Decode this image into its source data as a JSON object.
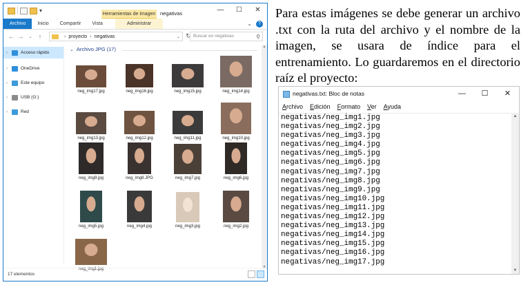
{
  "explorer": {
    "context_tab": "Herramientas de imagen",
    "window_title": "negativas",
    "tabs": [
      "Archivo",
      "Inicio",
      "Compartir",
      "Vista"
    ],
    "manage_tab": "Administrar",
    "breadcrumb": [
      "proyecto",
      "negativas"
    ],
    "search_placeholder": "Buscar en negativas",
    "nav_items": [
      {
        "label": "Acceso rápido",
        "icon": "star-icon",
        "selected": true
      },
      {
        "label": "OneDrive",
        "icon": "cloud-icon",
        "selected": false
      },
      {
        "label": "Este equipo",
        "icon": "computer-icon",
        "selected": false
      },
      {
        "label": "USB (G:)",
        "icon": "usb-drive-icon",
        "selected": false
      },
      {
        "label": "Red",
        "icon": "network-icon",
        "selected": false
      }
    ],
    "group_header": "Archivo JPG (17)",
    "files": [
      "neg_img17.jpg",
      "neg_img16.jpg",
      "neg_img15.jpg",
      "neg_img14.jpg",
      "neg_img13.jpg",
      "neg_img12.jpg",
      "neg_img11.jpg",
      "neg_img10.jpg",
      "neg_img9.jpg",
      "neg_img8.JPG",
      "neg_img7.jpg",
      "neg_img6.jpg",
      "neg_img5.jpg",
      "neg_img4.jpg",
      "neg_img3.jpg",
      "neg_img2.jpg",
      "neg_img1.jpg"
    ],
    "status": "17 elementos",
    "colors": {
      "accent": "#1979ca",
      "selection": "#cce8ff",
      "context_tab": "#fbe8a6"
    }
  },
  "paragraph": "Para estas imágenes se debe generar un archivo .txt con la ruta del archivo y el nombre de la imagen, se usara de índice para el entrenamiento. Lo guardaremos en el directorio raíz el proyecto:",
  "notepad": {
    "title": "negativas.txt: Bloc de notas",
    "menu": [
      {
        "accel": "A",
        "rest": "rchivo"
      },
      {
        "accel": "E",
        "rest": "dición"
      },
      {
        "accel": "F",
        "rest": "ormato"
      },
      {
        "accel": "V",
        "rest": "er"
      },
      {
        "accel": "A",
        "rest": "yuda"
      }
    ],
    "lines": [
      "negativas/neg_img1.jpg",
      "negativas/neg_img2.jpg",
      "negativas/neg_img3.jpg",
      "negativas/neg_img4.jpg",
      "negativas/neg_img5.jpg",
      "negativas/neg_img6.jpg",
      "negativas/neg_img7.jpg",
      "negativas/neg_img8.jpg",
      "negativas/neg_img9.jpg",
      "negativas/neg_img10.jpg",
      "negativas/neg_img11.jpg",
      "negativas/neg_img12.jpg",
      "negativas/neg_img13.jpg",
      "negativas/neg_img14.jpg",
      "negativas/neg_img15.jpg",
      "negativas/neg_img16.jpg",
      "negativas/neg_img17.jpg"
    ]
  }
}
